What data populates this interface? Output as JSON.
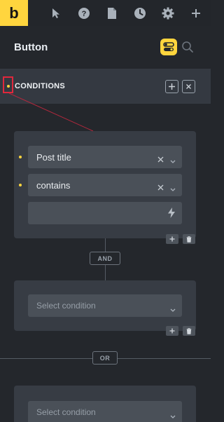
{
  "app": {
    "logo": "b"
  },
  "toolbar": {
    "icons": [
      "cursor-icon",
      "help-icon",
      "page-icon",
      "history-icon",
      "settings-icon",
      "plus-icon"
    ]
  },
  "panel": {
    "title": "Button"
  },
  "conditions": {
    "label": "CONDITIONS",
    "accent": "#ffd53e",
    "highlight": "#e0283c"
  },
  "groups": [
    {
      "rows": [
        {
          "value": "Post title"
        },
        {
          "value": "contains"
        },
        {
          "value": ""
        }
      ]
    },
    {
      "rows": [
        {
          "placeholder": "Select condition"
        }
      ]
    },
    {
      "rows": [
        {
          "placeholder": "Select condition"
        }
      ]
    }
  ],
  "connectors": {
    "and": "AND",
    "or": "OR"
  }
}
